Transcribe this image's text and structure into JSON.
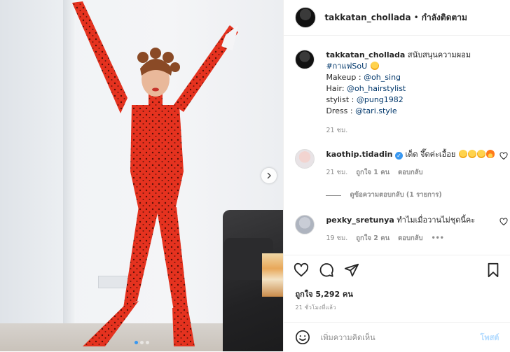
{
  "post": {
    "author": "takkatan_chollada",
    "follow_label": "กำลังติดตาม",
    "separator": "•",
    "caption": {
      "username": "takkatan_chollada",
      "text": "สนับสนุนความผอม",
      "hashtag": "#กาแฟSoU",
      "credits": [
        {
          "label": "Makeup : ",
          "handle": "@oh_sing"
        },
        {
          "label": "Hair: ",
          "handle": "@oh_hairstylist"
        },
        {
          "label": "stylist : ",
          "handle": "@pung1982"
        },
        {
          "label": "Dress : ",
          "handle": "@tari.style"
        }
      ],
      "time": "21 ชม."
    },
    "comments": [
      {
        "username": "kaothip.tidadin",
        "verified": true,
        "text": "เด็ด จึ๊ดค่ะเอื้อย",
        "time": "21 ชม.",
        "likes": "ถูกใจ 1 คน",
        "reply": "ตอบกลับ",
        "view_replies": "ดูข้อความตอบกลับ (1 รายการ)"
      },
      {
        "username": "pexky_sretunya",
        "verified": false,
        "text": "ทำไมเมื่อวานไม่ชุดนี้คะ",
        "time": "19 ชม.",
        "likes": "ถูกใจ 2 คน",
        "reply": "ตอบกลับ",
        "more": "•••"
      }
    ],
    "likes_text": "ถูกใจ 5,292 คน",
    "posted_ago": "21 ชั่วโมงที่แล้ว",
    "comment_placeholder": "เพิ่มความคิดเห็น",
    "post_button": "โพสต์"
  },
  "carousel": {
    "slides": 3,
    "active_index": 1
  },
  "icons": {
    "like": "heart-icon",
    "comment": "comment-icon",
    "share": "share-icon",
    "save": "bookmark-icon",
    "emoji": "smiley-icon",
    "next": "chevron-right-icon"
  },
  "colors": {
    "link": "#00376b",
    "muted": "#8e8e8e",
    "verified": "#3897f0",
    "dress": "#e5321f"
  }
}
